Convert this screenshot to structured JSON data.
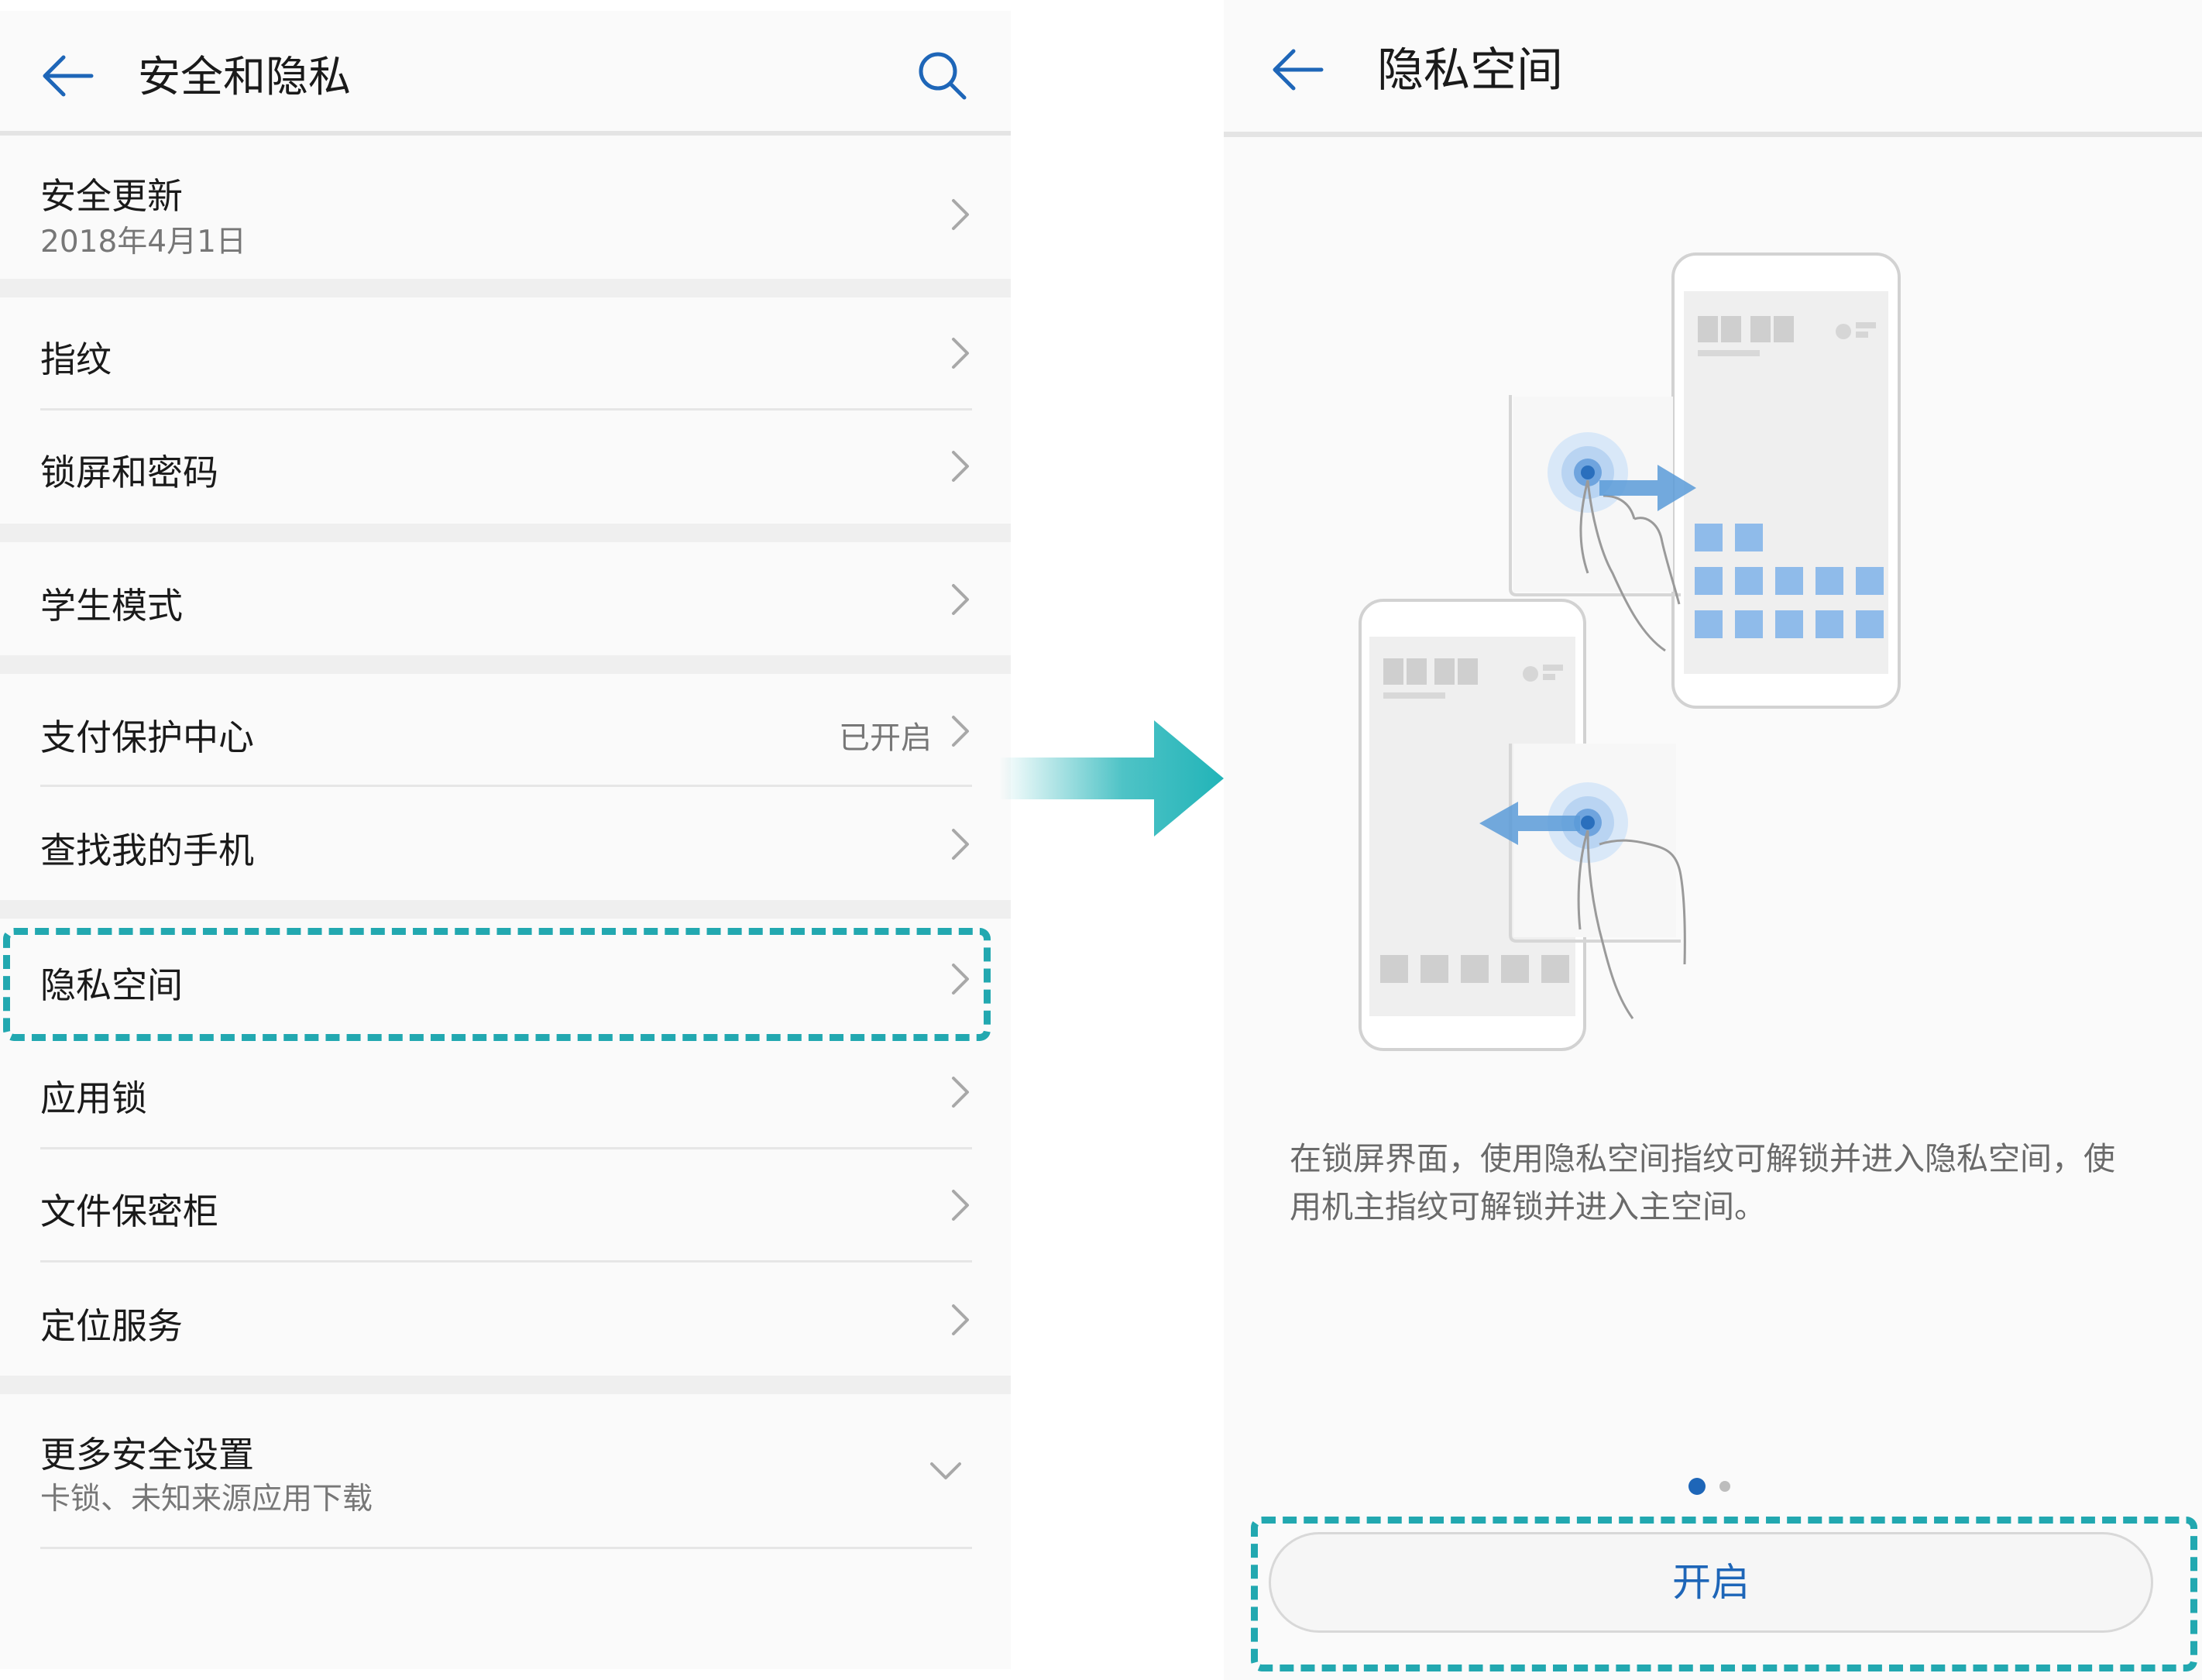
{
  "left_screen": {
    "title": "安全和隐私",
    "items": {
      "security_update": {
        "label": "安全更新",
        "sub": "2018年4月1日"
      },
      "fingerprint": {
        "label": "指纹"
      },
      "lock_password": {
        "label": "锁屏和密码"
      },
      "student_mode": {
        "label": "学生模式"
      },
      "payment_protection": {
        "label": "支付保护中心",
        "value": "已开启"
      },
      "find_my_phone": {
        "label": "查找我的手机"
      },
      "private_space": {
        "label": "隐私空间"
      },
      "app_lock": {
        "label": "应用锁"
      },
      "file_safe": {
        "label": "文件保密柜"
      },
      "location": {
        "label": "定位服务"
      },
      "more_settings": {
        "label": "更多安全设置",
        "sub": "卡锁、未知来源应用下载"
      }
    }
  },
  "right_screen": {
    "title": "隐私空间",
    "description": "在锁屏界面，使用隐私空间指纹可解锁并进入隐私空间，使用机主指纹可解锁并进入主空间。",
    "page_indicator": {
      "count": 2,
      "active": 1
    },
    "open_button": "开启"
  },
  "icons": {
    "back": "arrow-left-icon",
    "search": "search-icon",
    "chevron": "chevron-right-icon",
    "expand": "chevron-down-icon",
    "transition": "arrow-right-icon"
  },
  "colors": {
    "accent_blue": "#1e66b8",
    "highlight_teal": "#22a8b0",
    "illustration_blue": "#5b9bd8"
  }
}
